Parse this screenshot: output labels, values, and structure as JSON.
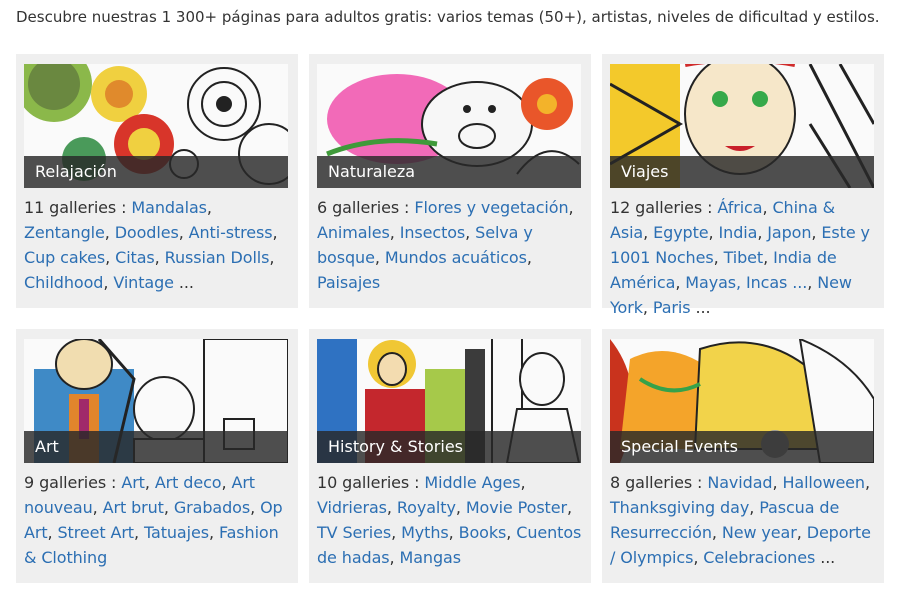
{
  "intro": "Descubre nuestras 1 300+ páginas para adultos gratis: varios temas (50+), artistas, niveles de dificultad y estilos.",
  "colors": {
    "link": "#2c6fb3",
    "card_bg": "#efefef",
    "ribbon": "#282828"
  },
  "cards": [
    {
      "title": "Relajación",
      "count": "11 galleries :",
      "links": [
        "Mandalas",
        "Zentangle",
        "Doodles",
        "Anti-stress",
        "Cup cakes",
        "Citas",
        "Russian Dolls",
        "Childhood",
        "Vintage"
      ],
      "more": "..."
    },
    {
      "title": "Naturaleza",
      "count": "6 galleries :",
      "links": [
        "Flores y vegetación",
        "Animales",
        "Insectos",
        "Selva y bosque",
        "Mundos acuáticos",
        "Paisajes"
      ],
      "more": ""
    },
    {
      "title": "Viajes",
      "count": "12 galleries :",
      "links": [
        "África",
        "China & Asia",
        "Egypte",
        "India",
        "Japon",
        "Este y 1001 Noches",
        "Tibet",
        "India de América",
        "Mayas, Incas ...",
        "New York",
        "Paris"
      ],
      "more": "..."
    },
    {
      "title": "Art",
      "count": "9 galleries :",
      "links": [
        "Art",
        "Art deco",
        "Art nouveau",
        "Art brut",
        "Grabados",
        "Op Art",
        "Street Art",
        "Tatuajes",
        "Fashion & Clothing"
      ],
      "more": ""
    },
    {
      "title": "History & Stories",
      "count": "10 galleries :",
      "links": [
        "Middle Ages",
        "Vidrieras",
        "Royalty",
        "Movie Poster",
        "TV Series",
        "Myths",
        "Books",
        "Cuentos de hadas",
        "Mangas"
      ],
      "more": ""
    },
    {
      "title": "Special Events",
      "count": "8 galleries :",
      "links": [
        "Navidad",
        "Halloween",
        "Thanksgiving day",
        "Pascua de Resurrección",
        "New year",
        "Deporte / Olympics",
        "Celebraciones"
      ],
      "more": "..."
    }
  ]
}
